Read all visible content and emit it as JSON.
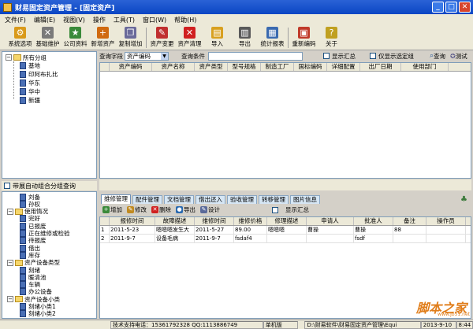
{
  "window": {
    "title": "财易固定资产管理 - [固定资产]"
  },
  "menu": [
    "文件(F)",
    "编辑(E)",
    "视图(V)",
    "操作",
    "工具(T)",
    "窗口(W)",
    "帮助(H)"
  ],
  "toolbar": [
    {
      "label": "系统选项",
      "icon": "settings-icon",
      "color": "#d99a1a",
      "glyph": "⚙"
    },
    {
      "label": "基础维护",
      "icon": "tools-icon",
      "color": "#7a7a7a",
      "glyph": "✕"
    },
    {
      "label": "公司资料",
      "icon": "company-icon",
      "color": "#3a8a3a",
      "glyph": "★"
    },
    {
      "label": "新增资产",
      "icon": "add-asset-icon",
      "color": "#d06a10",
      "glyph": "+"
    },
    {
      "label": "复制增加",
      "icon": "copy-icon",
      "color": "#6a6a9a",
      "glyph": "❐"
    },
    {
      "label": "资产变更",
      "icon": "edit-icon",
      "color": "#c03030",
      "glyph": "✎"
    },
    {
      "label": "资产清理",
      "icon": "delete-icon",
      "color": "#d02020",
      "glyph": "✕"
    },
    {
      "label": "导入",
      "icon": "import-icon",
      "color": "#d8a020",
      "glyph": "▤"
    },
    {
      "label": "导出",
      "icon": "export-icon",
      "color": "#5a5a5a",
      "glyph": "▥"
    },
    {
      "label": "统计报表",
      "icon": "report-icon",
      "color": "#3a6ab0",
      "glyph": "▦"
    },
    {
      "label": "重新编码",
      "icon": "recode-icon",
      "color": "#c03a2a",
      "glyph": "▣"
    },
    {
      "label": "关于",
      "icon": "about-icon",
      "color": "#c0a020",
      "glyph": "?"
    }
  ],
  "tree_top": {
    "root": "所有分组",
    "children": [
      "基地",
      "印阿布扎比",
      "华东",
      "华中",
      "新疆"
    ]
  },
  "left_checkbox": "带展自动组合分组查询",
  "tree_bottom": [
    {
      "text": "刘备",
      "indent": 2,
      "type": "leaf"
    },
    {
      "text": "孙权",
      "indent": 2,
      "type": "leaf"
    },
    {
      "text": "使用情况",
      "indent": 1,
      "type": "folder",
      "expand": "−"
    },
    {
      "text": "完好",
      "indent": 2,
      "type": "leaf"
    },
    {
      "text": "已报废",
      "indent": 2,
      "type": "leaf"
    },
    {
      "text": "正在维修或检验",
      "indent": 2,
      "type": "leaf"
    },
    {
      "text": "待报废",
      "indent": 2,
      "type": "leaf"
    },
    {
      "text": "借出",
      "indent": 2,
      "type": "leaf"
    },
    {
      "text": "库存",
      "indent": 2,
      "type": "leaf"
    },
    {
      "text": "资产设备类型",
      "indent": 1,
      "type": "folder",
      "expand": "−"
    },
    {
      "text": "刻绪",
      "indent": 2,
      "type": "leaf"
    },
    {
      "text": "暖清池",
      "indent": 2,
      "type": "leaf"
    },
    {
      "text": "车辆",
      "indent": 2,
      "type": "leaf"
    },
    {
      "text": "办公设备",
      "indent": 2,
      "type": "leaf"
    },
    {
      "text": "资产设备小类",
      "indent": 1,
      "type": "folder",
      "expand": "−"
    },
    {
      "text": "刻绪小类1",
      "indent": 2,
      "type": "leaf"
    },
    {
      "text": "刻绪小类2",
      "indent": 2,
      "type": "leaf"
    }
  ],
  "query": {
    "field_label": "查询字段",
    "field_value": "资产编码",
    "cond_label": "查询条件",
    "show_summary": "显示汇总",
    "only_selected": "仅显示选定组",
    "search": "查询",
    "test": "测试"
  },
  "grid1_columns": [
    "资产编码",
    "资产名称",
    "资产类型",
    "型号规格",
    "制造工厂",
    "国标编码",
    "详细配置",
    "出厂日期",
    "使用部门"
  ],
  "tabs": [
    "维修管理",
    "配件管理",
    "文档管理",
    "借出还入",
    "验收管理",
    "转移管理",
    "图片信息"
  ],
  "subtoolbar": [
    {
      "label": "增加",
      "icon": "add-icon",
      "color": "#3a8a3a",
      "glyph": "+"
    },
    {
      "label": "修改",
      "icon": "modify-icon",
      "color": "#c08a20",
      "glyph": "✎"
    },
    {
      "label": "删除",
      "icon": "delete-icon",
      "color": "#d02020",
      "glyph": "✕"
    },
    {
      "label": "导出",
      "icon": "export-icon",
      "color": "#2a6ab0",
      "glyph": "●"
    },
    {
      "label": "设计",
      "icon": "design-icon",
      "color": "#5a6a9a",
      "glyph": "✎"
    }
  ],
  "sub_show_summary": "显示汇总",
  "grid2_columns": [
    "报修时间",
    "故障描述",
    "维修时间",
    "维修价格",
    "修理描述",
    "申请人",
    "批准人",
    "备注",
    "操作员"
  ],
  "grid2_rows": [
    [
      "1",
      "2011-5-23",
      "嗯嗯嗯发生大",
      "2011-5-27",
      "89.00",
      "嗯嗯嗯",
      "曹操",
      "曹操",
      "88",
      ""
    ],
    [
      "2",
      "2011-9-7",
      "设备毛病",
      "2011-9-7",
      "fsdaf4",
      "",
      "",
      "fsdf",
      "",
      ""
    ]
  ],
  "status": [
    "技术支持电话：15361792328 QQ:1113886749",
    "单机版",
    "D:\\财易软件\\财易固定资产管理\\Equi",
    "2013-9-10",
    "8:44"
  ],
  "watermark": {
    "title": "脚本之家",
    "url": "www.jb51.net"
  }
}
